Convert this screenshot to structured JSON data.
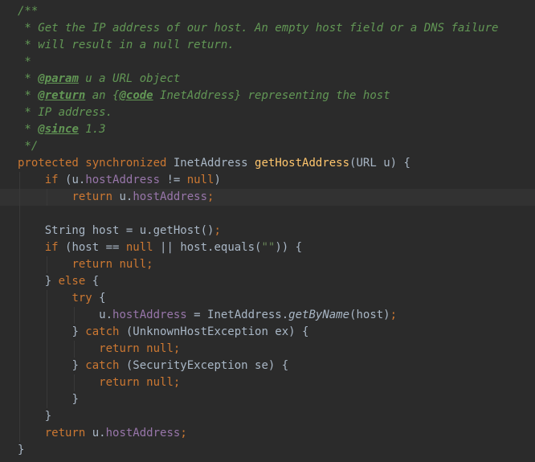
{
  "editor": {
    "colors": {
      "background": "#2b2b2b",
      "current_line": "#323232",
      "comment": "#629755",
      "keyword": "#cc7832",
      "method": "#ffc66d",
      "field": "#9876aa",
      "plain": "#a9b7c6"
    },
    "lines": [
      {
        "indent": 0,
        "tokens": [
          {
            "t": "/**",
            "c": "comment"
          }
        ]
      },
      {
        "indent": 0,
        "tokens": [
          {
            "t": " * Get the IP address of our host. An empty host field or a DNS failure",
            "c": "comment"
          }
        ]
      },
      {
        "indent": 0,
        "tokens": [
          {
            "t": " * will result in a null return.",
            "c": "comment"
          }
        ]
      },
      {
        "indent": 0,
        "tokens": [
          {
            "t": " *",
            "c": "comment"
          }
        ]
      },
      {
        "indent": 0,
        "tokens": [
          {
            "t": " * ",
            "c": "comment"
          },
          {
            "t": "@param",
            "c": "doctag"
          },
          {
            "t": " u a URL object",
            "c": "comment"
          }
        ]
      },
      {
        "indent": 0,
        "tokens": [
          {
            "t": " * ",
            "c": "comment"
          },
          {
            "t": "@return",
            "c": "doctag"
          },
          {
            "t": " an {",
            "c": "comment"
          },
          {
            "t": "@code",
            "c": "doctag"
          },
          {
            "t": " InetAddress} representing the host",
            "c": "comment"
          }
        ]
      },
      {
        "indent": 0,
        "tokens": [
          {
            "t": " * IP address.",
            "c": "comment"
          }
        ]
      },
      {
        "indent": 0,
        "tokens": [
          {
            "t": " * ",
            "c": "comment"
          },
          {
            "t": "@since",
            "c": "doctag"
          },
          {
            "t": " 1.3",
            "c": "comment"
          }
        ]
      },
      {
        "indent": 0,
        "tokens": [
          {
            "t": " */",
            "c": "comment"
          }
        ]
      },
      {
        "indent": 0,
        "tokens": [
          {
            "t": "protected synchronized ",
            "c": "keyword"
          },
          {
            "t": "InetAddress ",
            "c": "plain"
          },
          {
            "t": "getHostAddress",
            "c": "method"
          },
          {
            "t": "(URL u) {",
            "c": "plain"
          }
        ]
      },
      {
        "indent": 1,
        "tokens": [
          {
            "t": "if ",
            "c": "keyword"
          },
          {
            "t": "(u.",
            "c": "plain"
          },
          {
            "t": "hostAddress",
            "c": "field"
          },
          {
            "t": " != ",
            "c": "plain"
          },
          {
            "t": "null",
            "c": "keyword"
          },
          {
            "t": ")",
            "c": "plain"
          }
        ]
      },
      {
        "indent": 2,
        "current": true,
        "tokens": [
          {
            "t": "return ",
            "c": "keyword"
          },
          {
            "t": "u.",
            "c": "plain"
          },
          {
            "t": "hostAddress",
            "c": "field"
          },
          {
            "t": ";",
            "c": "keyword"
          }
        ]
      },
      {
        "indent": 1,
        "tokens": []
      },
      {
        "indent": 1,
        "tokens": [
          {
            "t": "String host = u.getHost()",
            "c": "plain"
          },
          {
            "t": ";",
            "c": "keyword"
          }
        ]
      },
      {
        "indent": 1,
        "tokens": [
          {
            "t": "if ",
            "c": "keyword"
          },
          {
            "t": "(host == ",
            "c": "plain"
          },
          {
            "t": "null ",
            "c": "keyword"
          },
          {
            "t": "|| host.equals(",
            "c": "plain"
          },
          {
            "t": "\"\"",
            "c": "string"
          },
          {
            "t": ")) {",
            "c": "plain"
          }
        ]
      },
      {
        "indent": 2,
        "tokens": [
          {
            "t": "return null;",
            "c": "keyword"
          }
        ]
      },
      {
        "indent": 1,
        "tokens": [
          {
            "t": "} ",
            "c": "plain"
          },
          {
            "t": "else ",
            "c": "keyword"
          },
          {
            "t": "{",
            "c": "plain"
          }
        ]
      },
      {
        "indent": 2,
        "tokens": [
          {
            "t": "try ",
            "c": "keyword"
          },
          {
            "t": "{",
            "c": "plain"
          }
        ]
      },
      {
        "indent": 3,
        "tokens": [
          {
            "t": "u.",
            "c": "plain"
          },
          {
            "t": "hostAddress",
            "c": "field"
          },
          {
            "t": " = InetAddress.",
            "c": "plain"
          },
          {
            "t": "getByName",
            "c": "static"
          },
          {
            "t": "(host)",
            "c": "plain"
          },
          {
            "t": ";",
            "c": "keyword"
          }
        ]
      },
      {
        "indent": 2,
        "tokens": [
          {
            "t": "} ",
            "c": "plain"
          },
          {
            "t": "catch ",
            "c": "keyword"
          },
          {
            "t": "(UnknownHostException ex) {",
            "c": "plain"
          }
        ]
      },
      {
        "indent": 3,
        "tokens": [
          {
            "t": "return null;",
            "c": "keyword"
          }
        ]
      },
      {
        "indent": 2,
        "tokens": [
          {
            "t": "} ",
            "c": "plain"
          },
          {
            "t": "catch ",
            "c": "keyword"
          },
          {
            "t": "(SecurityException se) {",
            "c": "plain"
          }
        ]
      },
      {
        "indent": 3,
        "tokens": [
          {
            "t": "return null;",
            "c": "keyword"
          }
        ]
      },
      {
        "indent": 2,
        "tokens": [
          {
            "t": "}",
            "c": "plain"
          }
        ]
      },
      {
        "indent": 1,
        "tokens": [
          {
            "t": "}",
            "c": "plain"
          }
        ]
      },
      {
        "indent": 1,
        "tokens": [
          {
            "t": "return ",
            "c": "keyword"
          },
          {
            "t": "u.",
            "c": "plain"
          },
          {
            "t": "hostAddress",
            "c": "field"
          },
          {
            "t": ";",
            "c": "keyword"
          }
        ]
      },
      {
        "indent": 0,
        "tokens": [
          {
            "t": "}",
            "c": "plain"
          }
        ]
      }
    ]
  }
}
